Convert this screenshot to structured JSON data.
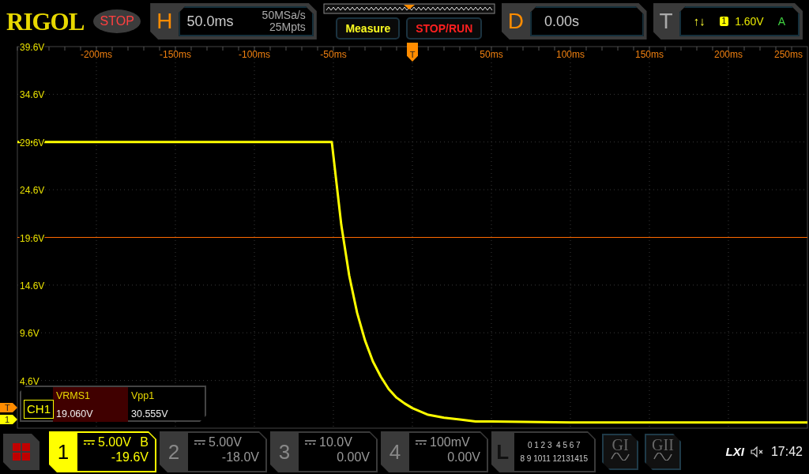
{
  "logo": "RIGOL",
  "run_state": "STOP",
  "horizontal": {
    "label": "H",
    "timebase": "50.0ms",
    "sample_rate": "50MSa/s",
    "memory_depth": "25Mpts"
  },
  "buttons": [
    {
      "label": "Measure",
      "kind": "measure"
    },
    {
      "label": "STOP/RUN",
      "kind": "stoprun"
    }
  ],
  "delay": {
    "label": "D",
    "value": "0.00s"
  },
  "trigger": {
    "label": "T",
    "slope": "↑↓",
    "source": "1",
    "level": "1.60V",
    "mode": "A"
  },
  "trigger_position": {
    "label": "T"
  },
  "chart_data": {
    "type": "line",
    "xlim": [
      -250,
      250
    ],
    "ylim": [
      -0.4,
      39.6
    ],
    "x": [
      -250,
      -200,
      -150,
      -100,
      -51,
      -45,
      -40,
      -35,
      -30,
      -25,
      -20,
      -15,
      -10,
      -5,
      0,
      10,
      20,
      30,
      40,
      50,
      100,
      150,
      200,
      250
    ],
    "series": [
      {
        "color": "#ffff00",
        "values": [
          29.6,
          29.6,
          29.6,
          29.6,
          29.6,
          20.9,
          15.6,
          11.7,
          8.8,
          6.6,
          5.0,
          3.7,
          2.8,
          2.2,
          1.7,
          1.0,
          0.7,
          0.5,
          0.3,
          0.3,
          0.2,
          0.2,
          0.2,
          0.2
        ]
      }
    ],
    "xticks": [
      {
        "value": -200,
        "label": "-200ms"
      },
      {
        "value": -150,
        "label": "-150ms"
      },
      {
        "value": -100,
        "label": "-100ms"
      },
      {
        "value": -50,
        "label": "-50ms"
      },
      {
        "value": 50,
        "label": "50ms"
      },
      {
        "value": 100,
        "label": "100ms"
      },
      {
        "value": 150,
        "label": "150ms"
      },
      {
        "value": 200,
        "label": "200ms"
      },
      {
        "value": 250,
        "label": "250ms"
      }
    ],
    "yticks": [
      {
        "value": 39.6,
        "label": "39.6V"
      },
      {
        "value": 34.6,
        "label": "34.6V"
      },
      {
        "value": 29.6,
        "label": "29.6V"
      },
      {
        "value": 24.6,
        "label": "24.6V"
      },
      {
        "value": 19.6,
        "label": "19.6V"
      },
      {
        "value": 14.6,
        "label": "14.6V"
      },
      {
        "value": 9.6,
        "label": "9.6V"
      },
      {
        "value": 4.6,
        "label": "4.6V"
      }
    ],
    "grid": true,
    "ref_lines": [
      {
        "axis": "y",
        "value": 19.6,
        "color": "#ff6a00"
      }
    ]
  },
  "markers": [
    {
      "label": "T",
      "kind": "trigger"
    },
    {
      "label": "1",
      "kind": "channel"
    }
  ],
  "measurements": {
    "source": "CH1",
    "items": [
      {
        "name": "VRMS1",
        "value": "19.060V",
        "selected": true
      },
      {
        "name": "Vpp1",
        "value": "30.555V",
        "selected": false
      }
    ]
  },
  "channels": [
    {
      "number": "1",
      "scale": "5.00V",
      "offset": "-19.6V",
      "bandwidth": "B",
      "selected": true
    },
    {
      "number": "2",
      "scale": "5.00V",
      "offset": "-18.0V",
      "selected": false
    },
    {
      "number": "3",
      "scale": "10.0V",
      "offset": "0.00V",
      "selected": false
    },
    {
      "number": "4",
      "scale": "100mV",
      "offset": "0.00V",
      "selected": false
    }
  ],
  "logic": {
    "label": "L",
    "row_1": "0 1 2 3  4 5 6 7",
    "row_2": "8 9 1011 12131415"
  },
  "generators": [
    {
      "label": "GI"
    },
    {
      "label": "GII"
    }
  ],
  "status": {
    "lxi": "LXI",
    "muted": true,
    "time": "17:42"
  }
}
